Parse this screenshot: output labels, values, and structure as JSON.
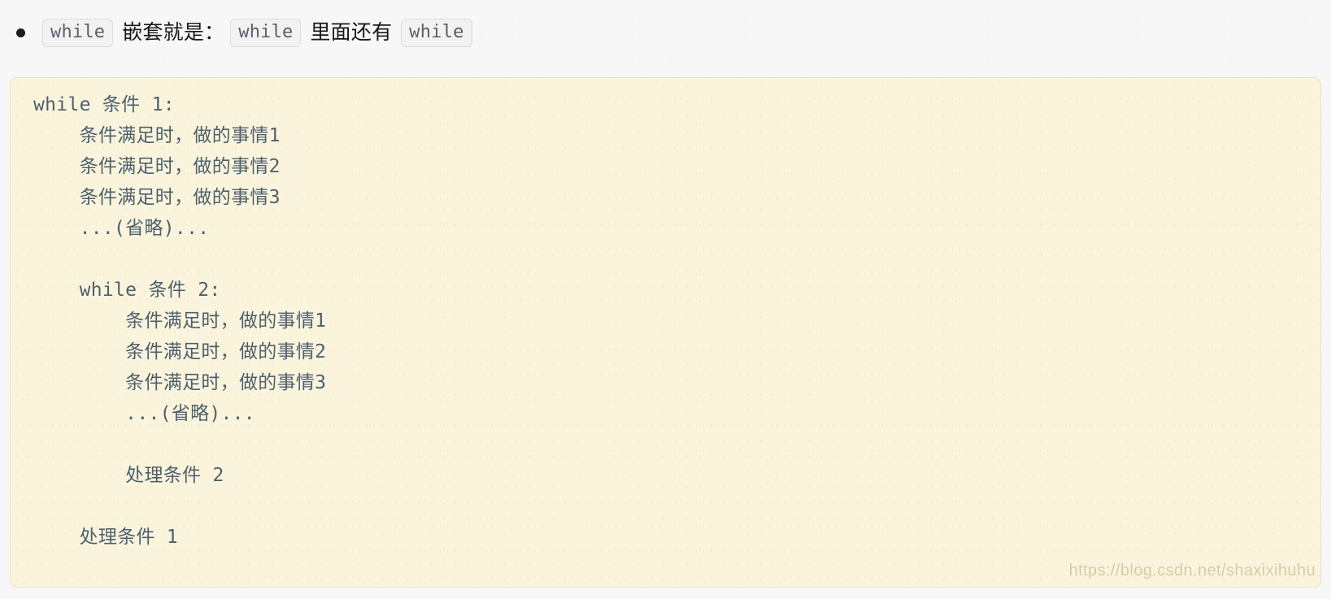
{
  "page": {
    "background_color": "#f7f7f7",
    "watermark": "https://blog.csdn.net/shaxixihuhu"
  },
  "header": {
    "bullet_glyph": "•",
    "bullet_icon_name": "bullet-dot-icon",
    "chip_1": "while",
    "text_1": "嵌套就是：",
    "chip_2": "while",
    "text_2": "里面还有",
    "chip_3": "while"
  },
  "code_block": {
    "background_color": "#faf4dd",
    "text_color": "#4e6067",
    "border_color": "#ece3c4",
    "language": "pseudocode",
    "lines": [
      "while 条件 1:",
      "    条件满足时，做的事情1",
      "    条件满足时，做的事情2",
      "    条件满足时，做的事情3",
      "    ...(省略)...",
      "",
      "    while 条件 2:",
      "        条件满足时，做的事情1",
      "        条件满足时，做的事情2",
      "        条件满足时，做的事情3",
      "        ...(省略)...",
      "",
      "        处理条件 2",
      "",
      "    处理条件 1"
    ]
  }
}
